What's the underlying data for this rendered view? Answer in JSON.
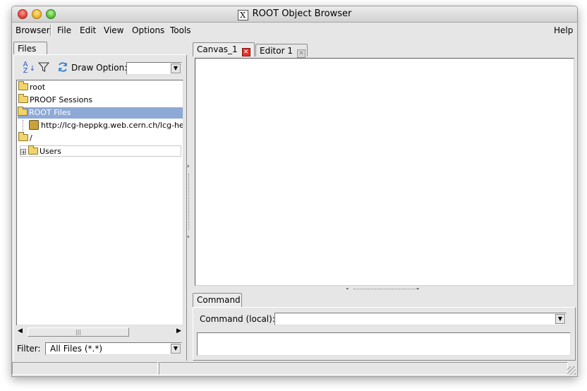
{
  "window": {
    "title": "ROOT Object Browser"
  },
  "menubar": {
    "items": [
      {
        "label": "Browser"
      },
      {
        "label": "File"
      },
      {
        "label": "Edit"
      },
      {
        "label": "View"
      },
      {
        "label": "Options"
      },
      {
        "label": "Tools"
      }
    ],
    "help": "Help"
  },
  "left": {
    "tab": "Files",
    "draw_option_label": "Draw Option:",
    "draw_option_value": "",
    "tree": [
      {
        "label": "root",
        "icon": "folder-icon"
      },
      {
        "label": "PROOF Sessions",
        "icon": "folder-icon"
      },
      {
        "label": "ROOT Files",
        "icon": "folder-open-icon",
        "selected": true
      },
      {
        "label": "http://lcg-heppkg.web.cern.ch/lcg-heppkg/f",
        "icon": "file-icon"
      },
      {
        "label": "/",
        "icon": "folder-open-icon"
      },
      {
        "label": "Users",
        "icon": "folder-icon"
      }
    ],
    "filter_label": "Filter:",
    "filter_value": "All Files (*.*)"
  },
  "right": {
    "tabs": [
      {
        "label": "Canvas_1"
      },
      {
        "label": "Editor 1"
      }
    ],
    "command_tab": "Command",
    "command_label": "Command (local):",
    "command_value": ""
  },
  "icons": {
    "sort": "sort-az-icon",
    "filter": "filter-funnel-icon",
    "refresh": "refresh-icon"
  },
  "colors": {
    "selection": "#8ea9d5",
    "close_active": "#e8332a",
    "window_bg": "#e6e6e6"
  }
}
